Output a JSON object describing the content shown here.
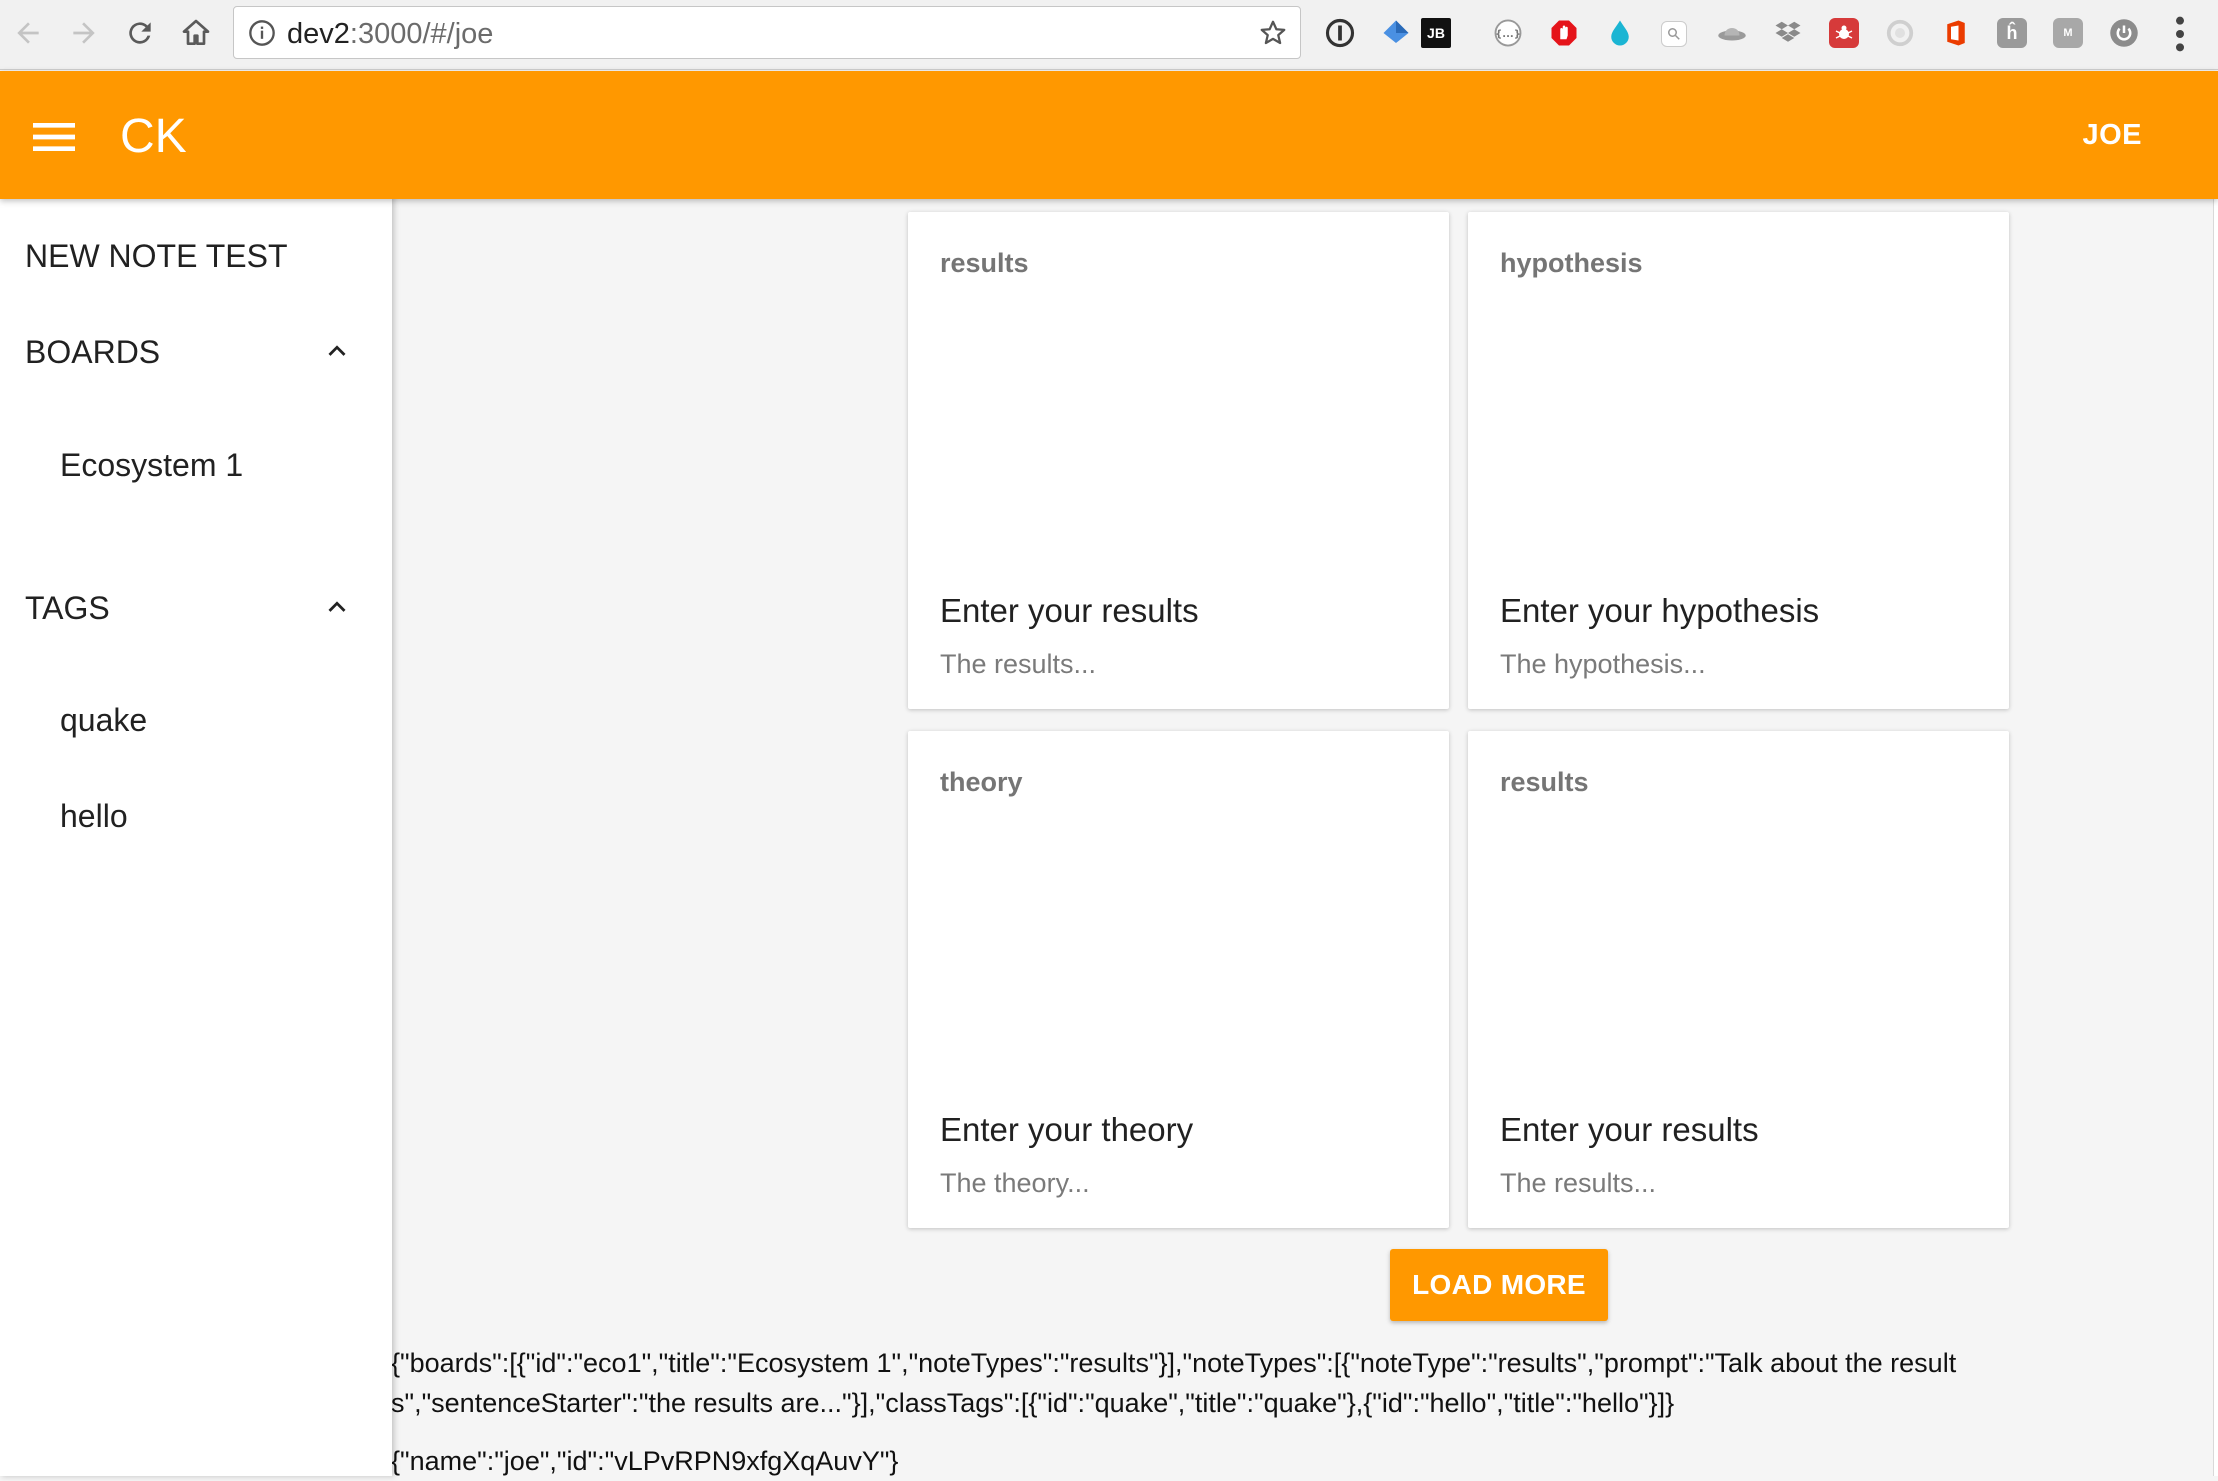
{
  "browser": {
    "url_host": "dev2",
    "url_path": ":3000/#/joe",
    "extensions": [
      "1password-icon",
      "bookmark-icon",
      "jb-icon",
      "json-icon",
      "adblock-icon",
      "droplet-icon",
      "search-ext-icon",
      "hat-icon",
      "dropbox-icon",
      "bug-icon",
      "circle-ext-icon",
      "office-icon",
      "h-ext-icon",
      "m-ext-icon",
      "power-icon"
    ],
    "ext_jb_label": "JB",
    "ext_h_label": "ĥ",
    "ext_m_label": "M"
  },
  "appbar": {
    "title": "CK",
    "user": "JOE",
    "color": "#ff9800"
  },
  "drawer": {
    "new_note": "NEW NOTE TEST",
    "boards_header": "BOARDS",
    "boards": [
      "Ecosystem 1"
    ],
    "tags_header": "TAGS",
    "tags": [
      "quake",
      "hello"
    ]
  },
  "cards": [
    {
      "type": "results",
      "title": "Enter your results",
      "sub": "The results..."
    },
    {
      "type": "hypothesis",
      "title": "Enter your hypothesis",
      "sub": "The hypothesis..."
    },
    {
      "type": "theory",
      "title": "Enter your theory",
      "sub": "The theory..."
    },
    {
      "type": "results",
      "title": "Enter your results",
      "sub": "The results..."
    }
  ],
  "load_more": "LOAD MORE",
  "debug": {
    "line1": "{\"boards\":[{\"id\":\"eco1\",\"title\":\"Ecosystem 1\",\"noteTypes\":\"results\"}],\"noteTypes\":[{\"noteType\":\"results\",\"prompt\":\"Talk about the results\",\"sentenceStarter\":\"the results are...\"}],\"classTags\":[{\"id\":\"quake\",\"title\":\"quake\"},{\"id\":\"hello\",\"title\":\"hello\"}]}",
    "line2": "{\"name\":\"joe\",\"id\":\"vLPvRPN9xfgXqAuvY\"}"
  }
}
